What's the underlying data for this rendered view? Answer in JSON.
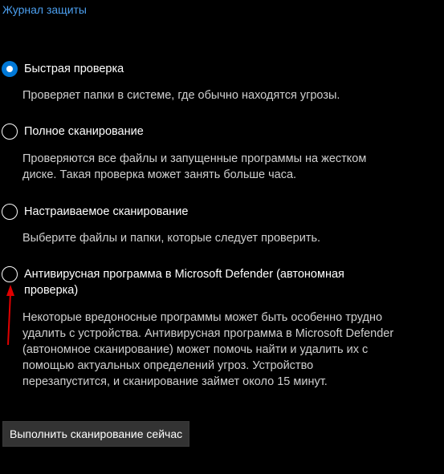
{
  "header": {
    "protection_history_link": "Журнал защиты"
  },
  "scan_options": [
    {
      "label": "Быстрая проверка",
      "description": "Проверяет папки в системе, где обычно находятся угрозы.",
      "selected": true
    },
    {
      "label": "Полное сканирование",
      "description": "Проверяются все файлы и запущенные программы на жестком диске. Такая проверка может занять больше часа.",
      "selected": false
    },
    {
      "label": "Настраиваемое сканирование",
      "description": "Выберите файлы и папки, которые следует проверить.",
      "selected": false
    },
    {
      "label": "Антивирусная программа в Microsoft Defender (автономная проверка)",
      "description": "Некоторые вредоносные программы может быть особенно трудно удалить с устройства. Антивирусная программа в Microsoft Defender (автономное сканирование) может помочь найти и удалить их с помощью актуальных определений угроз. Устройство перезапустится, и сканирование займет около 15 минут.",
      "selected": false
    }
  ],
  "actions": {
    "scan_now_label": "Выполнить сканирование сейчас"
  },
  "colors": {
    "background": "#000000",
    "accent": "#0078d7",
    "link": "#4ca0f0",
    "annotation_arrow": "#e00000"
  }
}
